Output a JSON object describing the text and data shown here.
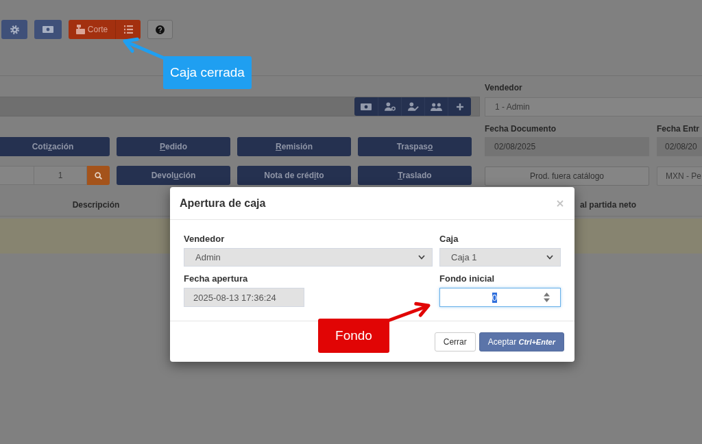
{
  "toolbar": [
    {
      "kind": "settings"
    },
    {
      "kind": "cash"
    },
    {
      "kind": "split",
      "label": "Corte"
    },
    {
      "kind": "help"
    }
  ],
  "customer_bar": {
    "actions": [
      {
        "kind": "cash"
      },
      {
        "kind": "client-payment"
      },
      {
        "kind": "client-edit"
      },
      {
        "kind": "clients"
      },
      {
        "kind": "add"
      }
    ]
  },
  "document_buttons": [
    {
      "before": "Coti",
      "key": "z",
      "after": "ación"
    },
    {
      "key": "P",
      "after": "edido"
    },
    {
      "key": "R",
      "after": "emisión"
    },
    {
      "before": "Traspas",
      "key": "o"
    },
    {
      "before": "Devol",
      "key": "u",
      "after": "ción"
    },
    {
      "before": "Nota de créd",
      "key": "i",
      "after": "to"
    },
    {
      "key": "T",
      "after": "raslado"
    }
  ],
  "product_entry": {
    "quantity": "1"
  },
  "document_panel": {
    "seller": {
      "label": "Vendedor",
      "value": "1 - Admin"
    },
    "document_date": {
      "label": "Fecha Documento",
      "value": "02/08/2025"
    },
    "delivery_date": {
      "label": "Fecha Entr",
      "value": "02/08/20"
    },
    "catalog_button": "Prod. fuera catálogo",
    "currency": "MXN - Pe"
  },
  "table": {
    "columns": [
      "Descripción",
      "al partida neto"
    ]
  },
  "modal": {
    "title": "Apertura de caja",
    "fields": [
      {
        "kind": "select",
        "label": "Vendedor",
        "value": "Admin",
        "disabled": true,
        "focused": false
      },
      {
        "kind": "select",
        "label": "Caja",
        "value": "Caja 1",
        "disabled": true,
        "focused": false
      },
      {
        "kind": "text",
        "label": "Fecha apertura",
        "value": "2025-08-13 17:36:24",
        "disabled": true,
        "focused": false
      },
      {
        "kind": "number",
        "label": "Fondo inicial",
        "value": "0",
        "disabled": false,
        "focused": true
      }
    ],
    "buttons": [
      {
        "kind": "secondary",
        "label": "Cerrar"
      },
      {
        "kind": "primary",
        "label": "Aceptar",
        "shortcut": "Ctrl+Enter"
      }
    ]
  },
  "annotations": [
    {
      "kind": "left",
      "text": "Caja cerrada",
      "color": "#1f9ff1"
    },
    {
      "kind": "right",
      "text": "Fondo",
      "color": "#e10505"
    }
  ]
}
